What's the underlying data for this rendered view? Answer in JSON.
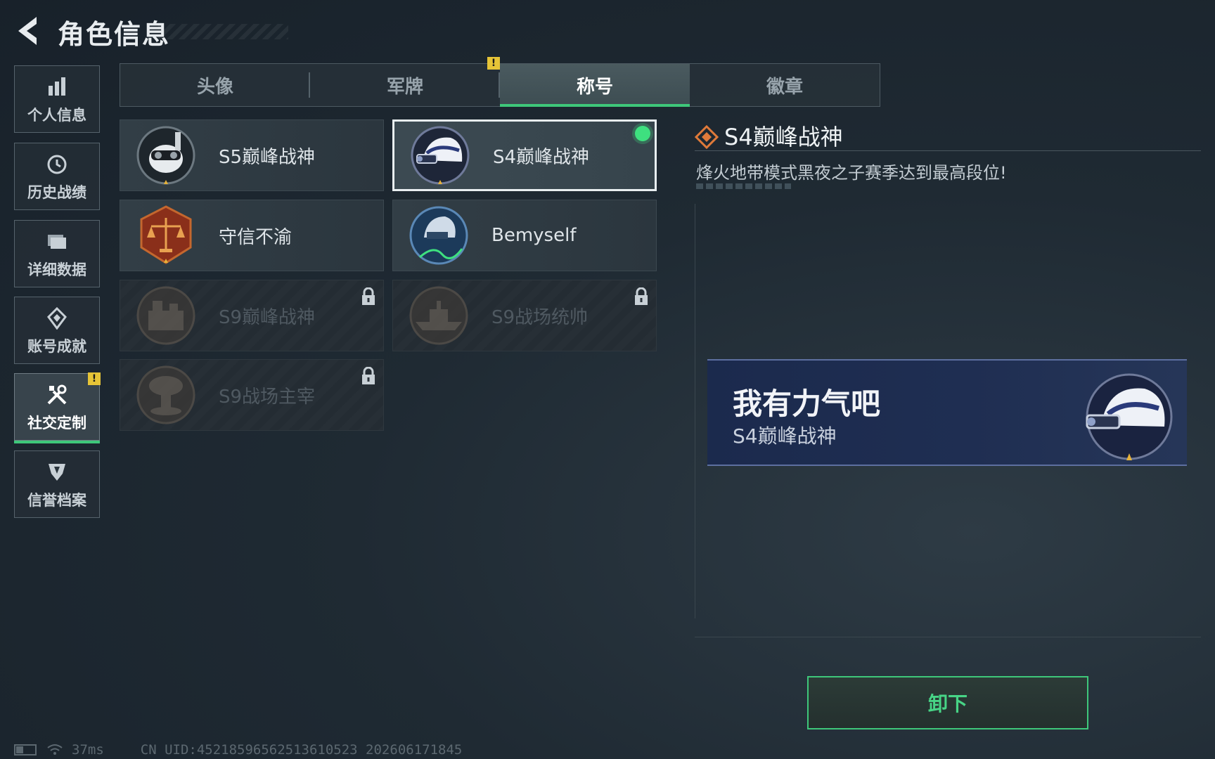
{
  "header": {
    "title": "角色信息"
  },
  "sidebar": {
    "items": [
      {
        "label": "个人信息",
        "icon": "bar-chart-icon"
      },
      {
        "label": "历史战绩",
        "icon": "clock-icon"
      },
      {
        "label": "详细数据",
        "icon": "folder-icon"
      },
      {
        "label": "账号成就",
        "icon": "achievement-icon"
      },
      {
        "label": "社交定制",
        "icon": "tools-icon",
        "active": true,
        "alert": "!"
      },
      {
        "label": "信誉档案",
        "icon": "shield-icon"
      }
    ]
  },
  "tabs": [
    {
      "label": "头像"
    },
    {
      "label": "军牌",
      "alert": "!"
    },
    {
      "label": "称号",
      "active": true
    },
    {
      "label": "徽章"
    }
  ],
  "titles": [
    {
      "name": "S5巅峰战神",
      "state": "owned",
      "emblem": "skull-diver-emblem-icon"
    },
    {
      "name": "S4巅峰战神",
      "state": "equipped",
      "emblem": "night-vision-helmet-emblem-icon"
    },
    {
      "name": "守信不渝",
      "state": "owned",
      "emblem": "scales-emblem-icon"
    },
    {
      "name": "Bemyself",
      "state": "owned",
      "emblem": "signature-helmet-emblem-icon"
    },
    {
      "name": "S9巅峰战神",
      "state": "locked",
      "emblem": "fortress-emblem-icon"
    },
    {
      "name": "S9战场统帅",
      "state": "locked",
      "emblem": "warship-emblem-icon"
    },
    {
      "name": "S9战场主宰",
      "state": "locked",
      "emblem": "mushroom-cloud-emblem-icon"
    }
  ],
  "detail": {
    "title": "S4巅峰战神",
    "description": "烽火地带模式黑夜之子赛季达到最高段位!"
  },
  "preview": {
    "nickname": "我有力气吧",
    "title": "S4巅峰战神"
  },
  "actions": {
    "unequip_label": "卸下"
  },
  "footer": {
    "ping": "37ms",
    "uid": "CN UID:452185965625136105​23 202606171845"
  },
  "colors": {
    "accent_green": "#3ec77a",
    "alert_yellow": "#e6c437",
    "banner_blue": "#1f2e52"
  }
}
